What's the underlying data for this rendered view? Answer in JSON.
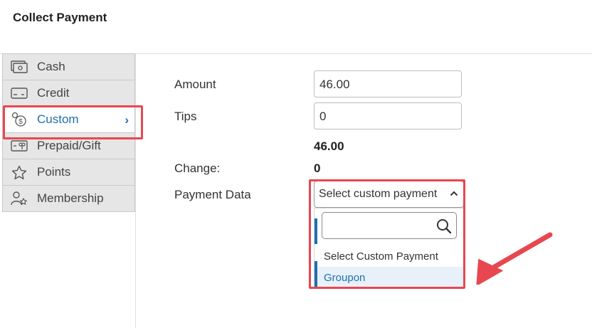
{
  "header": {
    "title": "Collect Payment"
  },
  "sidebar": {
    "items": [
      {
        "label": "Cash",
        "icon": "cash-icon"
      },
      {
        "label": "Credit",
        "icon": "credit-card-icon"
      },
      {
        "label": "Custom",
        "icon": "custom-coins-icon",
        "active": true
      },
      {
        "label": "Prepaid/Gift",
        "icon": "gift-card-icon"
      },
      {
        "label": "Points",
        "icon": "star-icon"
      },
      {
        "label": "Membership",
        "icon": "membership-icon"
      }
    ],
    "chevron": "›"
  },
  "form": {
    "amount_label": "Amount",
    "amount_value": "46.00",
    "tips_label": "Tips",
    "tips_value": "0",
    "total_value": "46.00",
    "change_label": "Change:",
    "change_value": "0",
    "payment_data_label": "Payment Data",
    "payment_select_value": "Select custom payment"
  },
  "dropdown": {
    "search_value": "",
    "options": [
      {
        "label": "Select Custom Payment",
        "highlighted": false
      },
      {
        "label": "Groupon",
        "highlighted": true
      }
    ]
  },
  "colors": {
    "accent": "#1f6fb0",
    "annotation": "#e8474f"
  }
}
